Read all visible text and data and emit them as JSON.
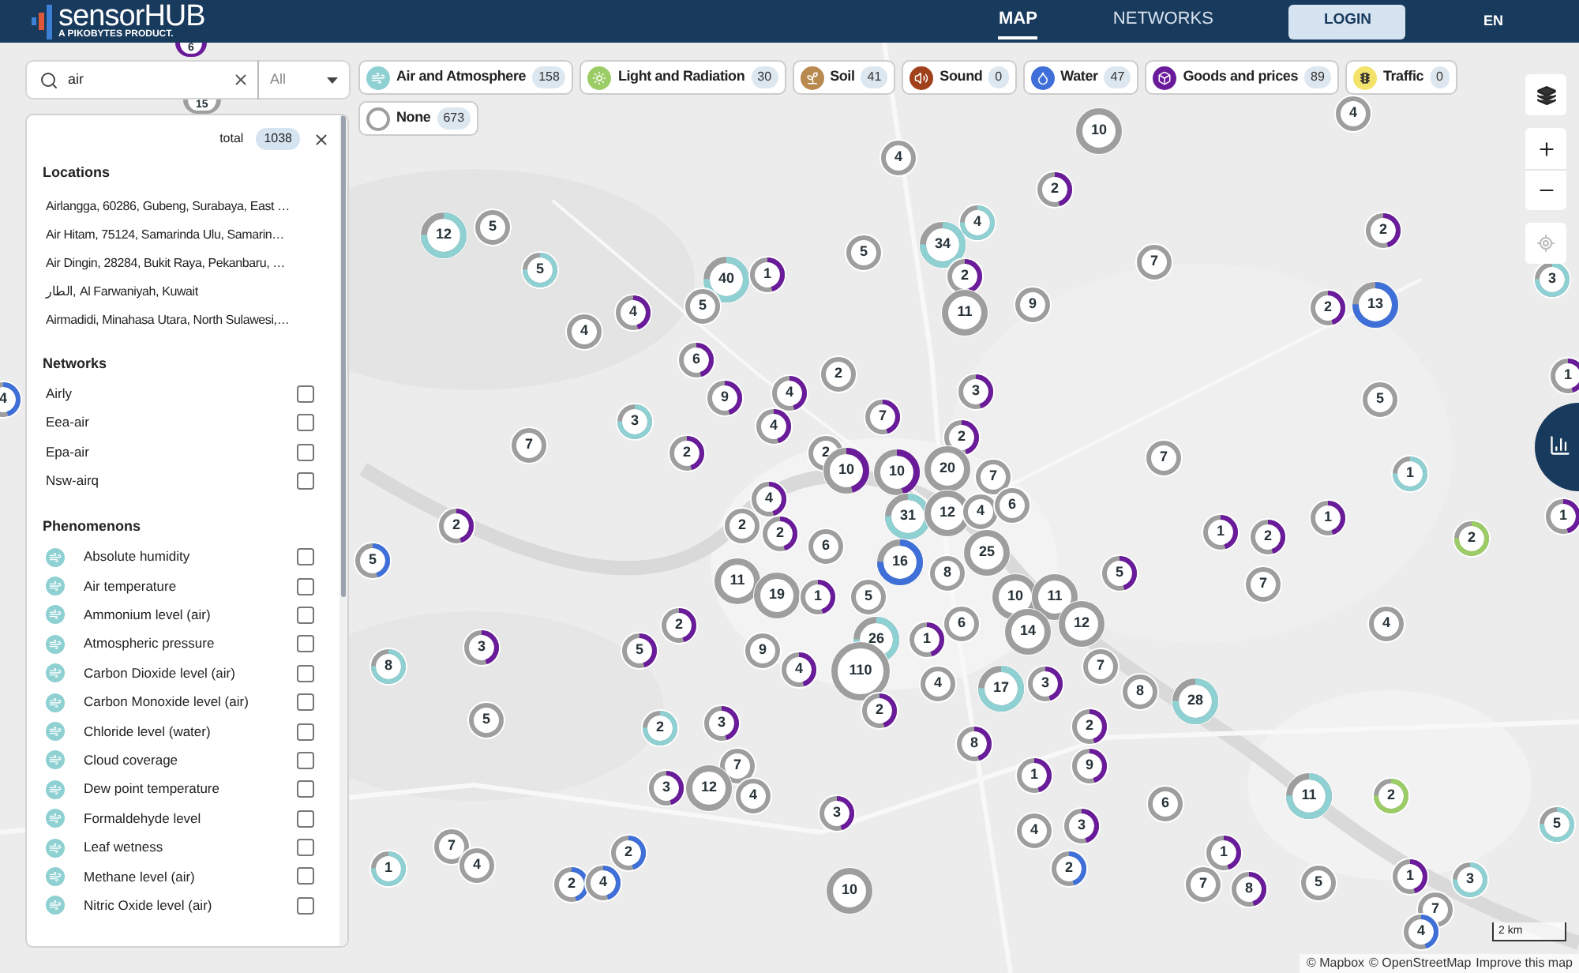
{
  "header": {
    "logo": "**sensor**HUB",
    "tagline": "A PIKOBYTES PRODUCT.",
    "nav": [
      {
        "label": "MAP",
        "selected": true
      },
      {
        "label": "NETWORKS",
        "selected": false
      }
    ],
    "login": "LOGIN",
    "language": "EN"
  },
  "search": {
    "value": "air",
    "scope": "All"
  },
  "categories": [
    {
      "kind": "air",
      "label": "Air and Atmosphere",
      "count": "158",
      "color": "#8fd0d3"
    },
    {
      "kind": "light",
      "label": "Light and Radiation",
      "count": "30",
      "color": "#9ccc65"
    },
    {
      "kind": "soil",
      "label": "Soil",
      "count": "41",
      "color": "#b88a4f"
    },
    {
      "kind": "sound",
      "label": "Sound",
      "count": "0",
      "color": "#a0411c"
    },
    {
      "kind": "water",
      "label": "Water",
      "count": "47",
      "color": "#3f6fd8"
    },
    {
      "kind": "goods",
      "label": "Goods and prices",
      "count": "89",
      "color": "#6a1b9a"
    },
    {
      "kind": "traffic",
      "label": "Traffic",
      "count": "0",
      "color": "#f3e36a"
    },
    {
      "kind": "none",
      "label": "None",
      "count": "673",
      "color": "#9e9e9e"
    }
  ],
  "panel": {
    "total_label": "total",
    "total": "1038",
    "locations": {
      "title": "Locations",
      "items": [
        "Airlangga, 60286, Gubeng, Surabaya, East …",
        "Air Hitam, 75124, Samarinda Ulu, Samarin…",
        "Air Dingin, 28284, Bukit Raya, Pekanbaru, …",
        "الطار, Al Farwaniyah, Kuwait",
        "Airmadidi, Minahasa Utara, North Sulawesi,…"
      ]
    },
    "networks": {
      "title": "Networks",
      "items": [
        {
          "label": "Airly",
          "checked": false
        },
        {
          "label": "Eea-air",
          "checked": false
        },
        {
          "label": "Epa-air",
          "checked": false
        },
        {
          "label": "Nsw-airq",
          "checked": false
        }
      ]
    },
    "phenomenons": {
      "title": "Phenomenons",
      "items": [
        {
          "label": "Absolute humidity",
          "checked": false
        },
        {
          "label": "Air temperature",
          "checked": false
        },
        {
          "label": "Ammonium level (air)",
          "checked": false
        },
        {
          "label": "Atmospheric pressure",
          "checked": false
        },
        {
          "label": "Carbon Dioxide level (air)",
          "checked": false
        },
        {
          "label": "Carbon Monoxide level (air)",
          "checked": false
        },
        {
          "label": "Chloride level (water)",
          "checked": false
        },
        {
          "label": "Cloud coverage",
          "checked": false
        },
        {
          "label": "Dew point temperature",
          "checked": false
        },
        {
          "label": "Formaldehyde level",
          "checked": false
        },
        {
          "label": "Leaf wetness",
          "checked": false
        },
        {
          "label": "Methane level (air)",
          "checked": false
        },
        {
          "label": "Nitric Oxide level (air)",
          "checked": false
        }
      ]
    }
  },
  "markers": [
    {
      "count": "6",
      "color": "#6a1b9a",
      "clipped": true
    },
    {
      "count": "15",
      "color": "#9e9e9e",
      "clipped": true
    },
    {
      "count": "10",
      "color": "#9e9e9e"
    },
    {
      "count": "2",
      "color": "#6a1b9a"
    },
    {
      "count": "4",
      "color": "#9e9e9e"
    },
    {
      "count": "4",
      "color": "#9e9e9e"
    },
    {
      "count": "5",
      "color": "#9e9e9e"
    },
    {
      "count": "12",
      "color": "#8fd0d3"
    },
    {
      "count": "5",
      "color": "#8fd0d3"
    },
    {
      "count": "5",
      "color": "#9e9e9e"
    },
    {
      "count": "4",
      "color": "#8fd0d3"
    },
    {
      "count": "34",
      "color": "#8fd0d3"
    },
    {
      "count": "40",
      "color": "#8fd0d3"
    },
    {
      "count": "1",
      "color": "#6a1b9a"
    },
    {
      "count": "5",
      "color": "#9e9e9e"
    },
    {
      "count": "4",
      "color": "#6a1b9a"
    },
    {
      "count": "4",
      "color": "#9e9e9e"
    },
    {
      "count": "2",
      "color": "#6a1b9a"
    },
    {
      "count": "11",
      "color": "#9e9e9e"
    },
    {
      "count": "9",
      "color": "#9e9e9e"
    },
    {
      "count": "7",
      "color": "#9e9e9e"
    },
    {
      "count": "2",
      "color": "#6a1b9a"
    },
    {
      "count": "2",
      "color": "#6a1b9a"
    },
    {
      "count": "13",
      "color": "#3f6fd8"
    },
    {
      "count": "3",
      "color": "#8fd0d3"
    },
    {
      "count": "6",
      "color": "#6a1b9a"
    },
    {
      "count": "4",
      "color": "#6a1b9a"
    },
    {
      "count": "2",
      "color": "#9e9e9e"
    },
    {
      "count": "9",
      "color": "#6a1b9a"
    },
    {
      "count": "3",
      "color": "#6a1b9a"
    },
    {
      "count": "4",
      "color": "#6a1b9a"
    },
    {
      "count": "7",
      "color": "#6a1b9a"
    },
    {
      "count": "3",
      "color": "#8fd0d3"
    },
    {
      "count": "7",
      "color": "#9e9e9e"
    },
    {
      "count": "2",
      "color": "#6a1b9a"
    },
    {
      "count": "2",
      "color": "#9e9e9e"
    },
    {
      "count": "2",
      "color": "#6a1b9a"
    },
    {
      "count": "5",
      "color": "#9e9e9e"
    },
    {
      "count": "7",
      "color": "#9e9e9e"
    },
    {
      "count": "1",
      "color": "#6a1b9a"
    },
    {
      "count": "4",
      "color": "#3f6fd8"
    },
    {
      "count": "10",
      "color": "#6a1b9a"
    },
    {
      "count": "10",
      "color": "#6a1b9a"
    },
    {
      "count": "20",
      "color": "#9e9e9e"
    },
    {
      "count": "7",
      "color": "#9e9e9e"
    },
    {
      "count": "4",
      "color": "#6a1b9a"
    },
    {
      "count": "2",
      "color": "#6a1b9a"
    },
    {
      "count": "2",
      "color": "#9e9e9e"
    },
    {
      "count": "31",
      "color": "#8fd0d3"
    },
    {
      "count": "12",
      "color": "#9e9e9e"
    },
    {
      "count": "4",
      "color": "#9e9e9e"
    },
    {
      "count": "6",
      "color": "#9e9e9e"
    },
    {
      "count": "2",
      "color": "#6a1b9a"
    },
    {
      "count": "6",
      "color": "#9e9e9e"
    },
    {
      "count": "16",
      "color": "#3f6fd8"
    },
    {
      "count": "8",
      "color": "#9e9e9e"
    },
    {
      "count": "25",
      "color": "#9e9e9e"
    },
    {
      "count": "1",
      "color": "#6a1b9a"
    },
    {
      "count": "2",
      "color": "#6a1b9a"
    },
    {
      "count": "1",
      "color": "#6a1b9a"
    },
    {
      "count": "1",
      "color": "#8fd0d3"
    },
    {
      "count": "2",
      "color": "#9ccc65"
    },
    {
      "count": "1",
      "color": "#6a1b9a"
    },
    {
      "count": "5",
      "color": "#3f6fd8"
    },
    {
      "count": "11",
      "color": "#9e9e9e"
    },
    {
      "count": "19",
      "color": "#9e9e9e"
    },
    {
      "count": "1",
      "color": "#6a1b9a"
    },
    {
      "count": "5",
      "color": "#9e9e9e"
    },
    {
      "count": "5",
      "color": "#6a1b9a"
    },
    {
      "count": "10",
      "color": "#9e9e9e"
    },
    {
      "count": "11",
      "color": "#9e9e9e"
    },
    {
      "count": "7",
      "color": "#9e9e9e"
    },
    {
      "count": "12",
      "color": "#9e9e9e"
    },
    {
      "count": "3",
      "color": "#6a1b9a"
    },
    {
      "count": "2",
      "color": "#6a1b9a"
    },
    {
      "count": "5",
      "color": "#6a1b9a"
    },
    {
      "count": "9",
      "color": "#9e9e9e"
    },
    {
      "count": "4",
      "color": "#6a1b9a"
    },
    {
      "count": "26",
      "color": "#8fd0d3"
    },
    {
      "count": "1",
      "color": "#6a1b9a"
    },
    {
      "count": "6",
      "color": "#9e9e9e"
    },
    {
      "count": "14",
      "color": "#9e9e9e"
    },
    {
      "count": "8",
      "color": "#8fd0d3"
    },
    {
      "count": "110",
      "color": "#9e9e9e"
    },
    {
      "count": "4",
      "color": "#9e9e9e"
    },
    {
      "count": "17",
      "color": "#8fd0d3"
    },
    {
      "count": "3",
      "color": "#6a1b9a"
    },
    {
      "count": "7",
      "color": "#9e9e9e"
    },
    {
      "count": "8",
      "color": "#9e9e9e"
    },
    {
      "count": "28",
      "color": "#8fd0d3"
    },
    {
      "count": "4",
      "color": "#9e9e9e"
    },
    {
      "count": "5",
      "color": "#9e9e9e"
    },
    {
      "count": "2",
      "color": "#8fd0d3"
    },
    {
      "count": "3",
      "color": "#6a1b9a"
    },
    {
      "count": "2",
      "color": "#6a1b9a"
    },
    {
      "count": "8",
      "color": "#6a1b9a"
    },
    {
      "count": "2",
      "color": "#6a1b9a"
    },
    {
      "count": "9",
      "color": "#6a1b9a"
    },
    {
      "count": "7",
      "color": "#9e9e9e"
    },
    {
      "count": "3",
      "color": "#6a1b9a"
    },
    {
      "count": "12",
      "color": "#9e9e9e"
    },
    {
      "count": "4",
      "color": "#9e9e9e"
    },
    {
      "count": "3",
      "color": "#6a1b9a"
    },
    {
      "count": "1",
      "color": "#6a1b9a"
    },
    {
      "count": "11",
      "color": "#8fd0d3"
    },
    {
      "count": "2",
      "color": "#9ccc65"
    },
    {
      "count": "5",
      "color": "#8fd0d3"
    },
    {
      "count": "6",
      "color": "#9e9e9e"
    },
    {
      "count": "7",
      "color": "#9e9e9e"
    },
    {
      "count": "4",
      "color": "#9e9e9e"
    },
    {
      "count": "2",
      "color": "#3f6fd8"
    },
    {
      "count": "1",
      "color": "#8fd0d3"
    },
    {
      "count": "2",
      "color": "#3f6fd8"
    },
    {
      "count": "4",
      "color": "#3f6fd8"
    },
    {
      "count": "10",
      "color": "#9e9e9e"
    },
    {
      "count": "4",
      "color": "#9e9e9e"
    },
    {
      "count": "3",
      "color": "#6a1b9a"
    },
    {
      "count": "2",
      "color": "#3f6fd8"
    },
    {
      "count": "1",
      "color": "#6a1b9a"
    },
    {
      "count": "7",
      "color": "#9e9e9e"
    },
    {
      "count": "8",
      "color": "#6a1b9a"
    },
    {
      "count": "5",
      "color": "#9e9e9e"
    },
    {
      "count": "1",
      "color": "#6a1b9a"
    },
    {
      "count": "3",
      "color": "#8fd0d3"
    },
    {
      "count": "7",
      "color": "#9e9e9e"
    },
    {
      "count": "4",
      "color": "#3f6fd8"
    }
  ],
  "scale": "2 km",
  "attribution": {
    "parts": [
      "© Mapbox",
      "© OpenStreetMap",
      "Improve this map"
    ]
  }
}
